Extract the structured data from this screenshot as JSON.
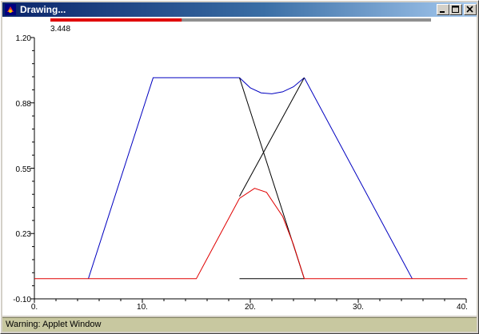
{
  "window": {
    "title": "Drawing...",
    "status": "Warning: Applet Window",
    "controls": [
      "minimize",
      "maximize",
      "close"
    ]
  },
  "progress": {
    "value_label": "3.448",
    "fraction": 0.345,
    "fill_color": "#e00000",
    "track_color": "#909090"
  },
  "colors": {
    "curve": "#0000c0",
    "intersection": "#e00000",
    "lines": "#000000"
  },
  "chart_data": {
    "type": "line",
    "x_ticks": [
      "0.",
      "10.",
      "20.",
      "30.",
      "40."
    ],
    "y_ticks": [
      "1.20",
      "0.88",
      "0.55",
      "0.23",
      "-0.10"
    ],
    "xlim": [
      0,
      40
    ],
    "ylim": [
      -0.1,
      1.2
    ],
    "series": [
      {
        "color": "#0000c0",
        "x": [
          5,
          11,
          19
        ],
        "y": [
          0,
          1,
          1
        ]
      },
      {
        "color": "#0000c0",
        "x": [
          25,
          35
        ],
        "y": [
          1,
          0
        ]
      },
      {
        "color": "#0000c0",
        "x": [
          19,
          20,
          21,
          22,
          23,
          24,
          25
        ],
        "y": [
          1,
          0.95,
          0.925,
          0.92,
          0.93,
          0.955,
          1
        ]
      },
      {
        "color": "#000000",
        "x": [
          19,
          25
        ],
        "y": [
          1,
          0
        ]
      },
      {
        "color": "#000000",
        "x": [
          19,
          25
        ],
        "y": [
          0.41,
          1
        ]
      },
      {
        "color": "#000000",
        "x": [
          19,
          25
        ],
        "y": [
          0,
          0
        ]
      },
      {
        "color": "#e00000",
        "x": [
          0,
          15,
          17,
          19,
          20.4,
          21.5,
          23,
          24,
          25,
          41
        ],
        "y": [
          0,
          0,
          0.2,
          0.4,
          0.45,
          0.43,
          0.31,
          0.17,
          0,
          0
        ]
      }
    ]
  }
}
